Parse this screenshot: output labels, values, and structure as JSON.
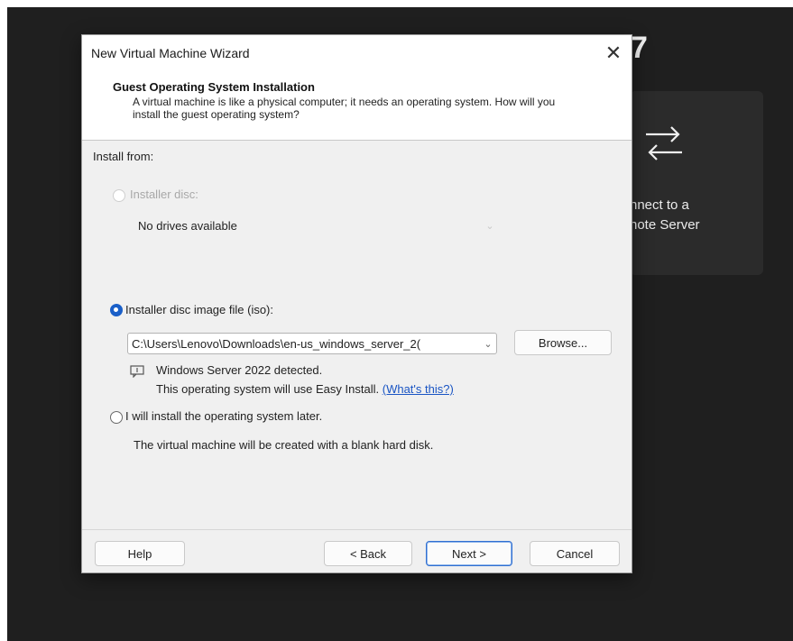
{
  "background": {
    "title_fragment": "7",
    "card": {
      "icon": "connect-arrows-icon",
      "label_line1": "nnect to a",
      "label_line2": "note Server"
    }
  },
  "dialog": {
    "title": "New Virtual Machine Wizard",
    "header_title": "Guest Operating System Installation",
    "header_desc": "A virtual machine is like a physical computer; it needs an operating system. How will you install the guest operating system?",
    "install_from_label": "Install from:",
    "option_disc": {
      "label": "Installer disc:",
      "selected": false,
      "enabled": false
    },
    "disc_dropdown_value": "No drives available",
    "option_iso": {
      "label": "Installer disc image file (iso):",
      "selected": true,
      "enabled": true
    },
    "iso_path_value": "C:\\Users\\Lenovo\\Downloads\\en-us_windows_server_2(",
    "browse_label": "Browse...",
    "detected_text": "Windows Server 2022 detected.",
    "easy_install_text": "This operating system will use Easy Install.",
    "whats_this_link": "(What's this?)",
    "option_later": {
      "label": "I will install the operating system later.",
      "selected": false,
      "enabled": true
    },
    "later_desc": "The virtual machine will be created with a blank hard disk.",
    "buttons": {
      "help": "Help",
      "back": "< Back",
      "next": "Next >",
      "cancel": "Cancel"
    },
    "close_glyph": "✕"
  },
  "colors": {
    "accent": "#1a5fc8",
    "link": "#1a55c4",
    "dark_bg": "#1f1f1f",
    "card_bg": "#2b2b2b"
  }
}
